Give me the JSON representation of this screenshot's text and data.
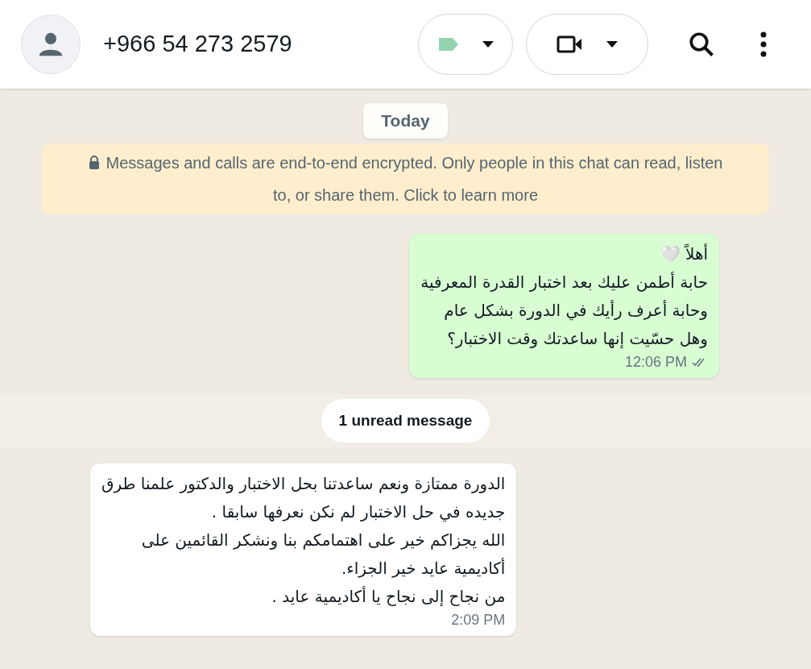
{
  "header": {
    "contact": "+966 54 273 2579"
  },
  "date_chip": "Today",
  "encryption_notice": "Messages and calls are end-to-end encrypted. Only people in this chat can read, listen to, or share them. Click to learn more",
  "messages": [
    {
      "kind": "outgoing",
      "text": "أهلاً 🤍\nحابة أطمن عليك بعد اختبار القدرة المعرفية\nوحابة أعرف رأيك في الدورة بشكل عام\nوهل حسّيت إنها ساعدتك وقت الاختبار؟",
      "time": "12:06 PM",
      "read": false
    },
    {
      "kind": "divider",
      "text": "1 unread message"
    },
    {
      "kind": "incoming",
      "text": "الدورة ممتازة ونعم ساعدتنا بحل الاختبار والدكتور علمنا طرق\nجديده في حل الاختبار لم نكن نعرفها سابقا .\nالله يجزاكم خير على اهتمامكم بنا ونشكر القائمين على\nأكاديمية عايد خير الجزاء.\nمن نجاح إلى نجاح يا أكاديمية عايد .",
      "time": "2:09 PM"
    }
  ]
}
